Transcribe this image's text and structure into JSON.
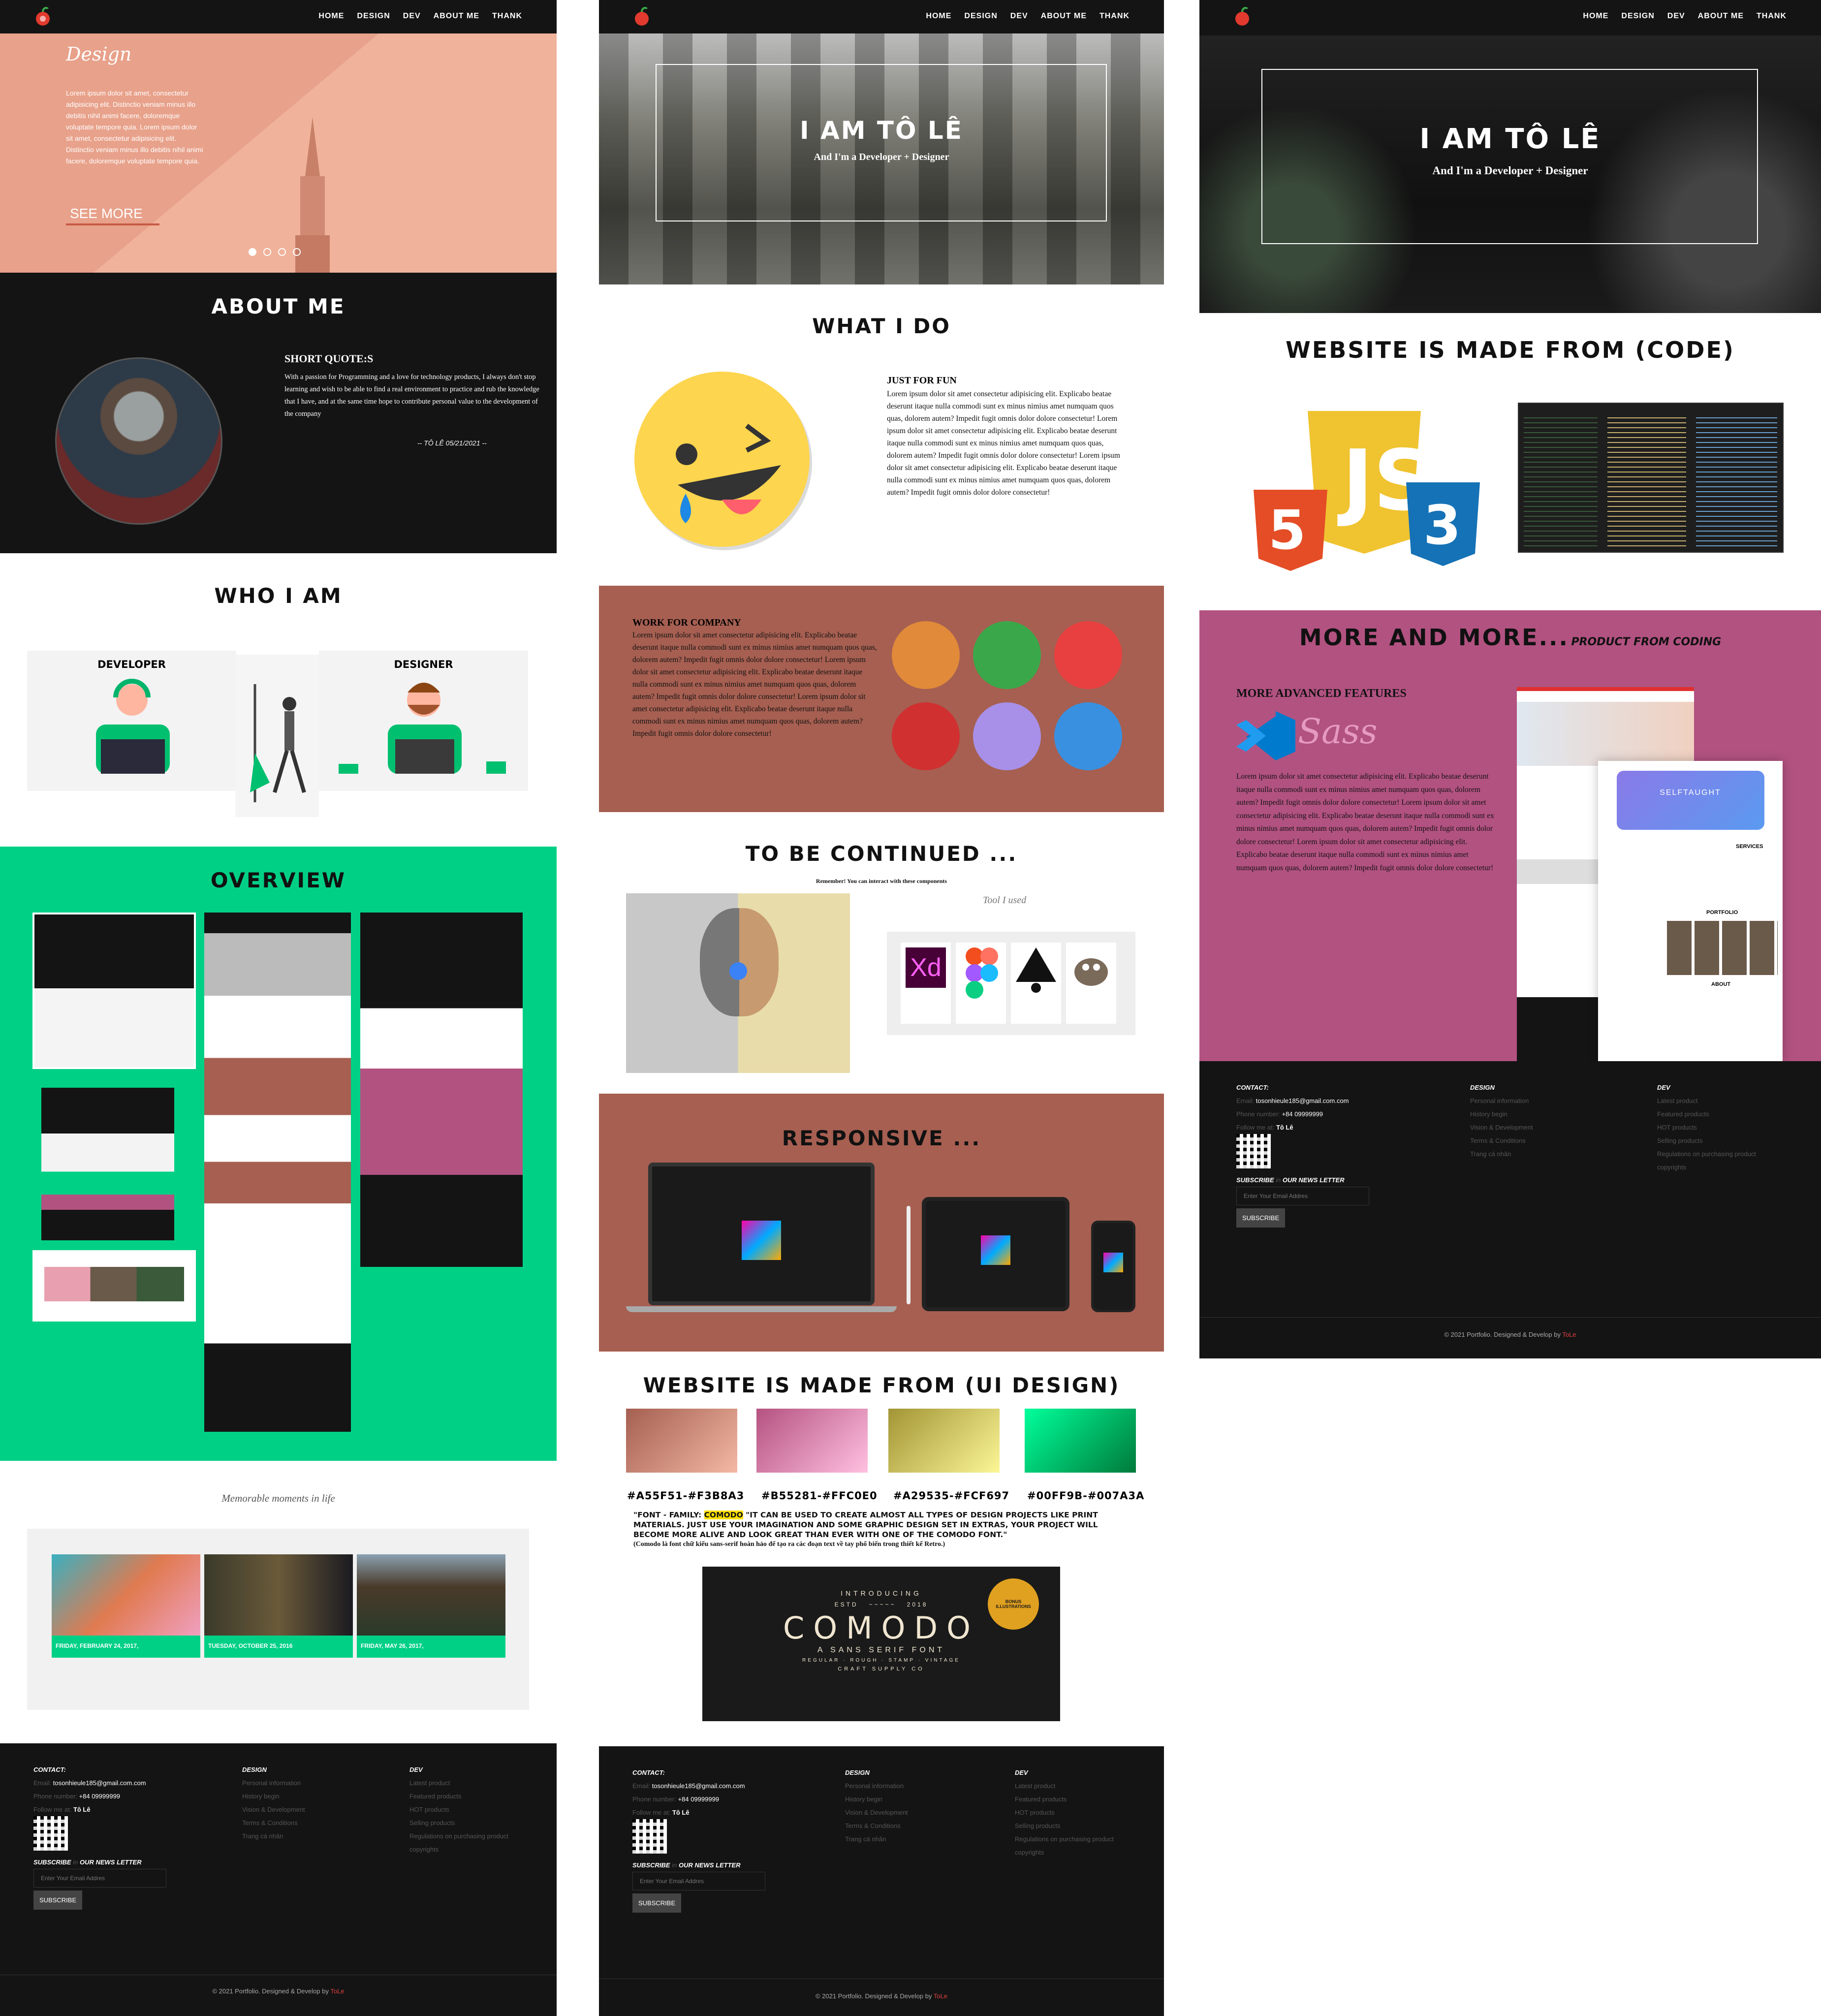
{
  "nav": {
    "items": [
      "HOME",
      "DESIGN",
      "DEV",
      "ABOUT ME",
      "THANK"
    ]
  },
  "col1": {
    "hero": {
      "title": "Design",
      "text": "Lorem ipsum dolor sit amet, consectetur adipisicing elit. Distinctio veniam minus illo debitis nihil animi facere, doloremque voluptate tempore quia. Lorem ipsum dolor sit amet, consectetur adipisicing elit. Distinctio veniam minus illo debitis nihil animi facere, doloremque voluptate tempore quia.",
      "button": "SEE MORE"
    },
    "about": {
      "title": "ABOUT ME",
      "quote_label": "SHORT QUOTE:S",
      "quote": "With a passion for Programming and a love for technology products, I always don't stop learning and wish to be able to find a real environment to practice and rub the knowledge that I have, and at the same time hope to contribute personal value to the development of the company",
      "signature": "-- TÔ LÊ 05/21/2021 --"
    },
    "who": {
      "title": "WHO I AM",
      "developer": "DEVELOPER",
      "designer": "DESIGNER"
    },
    "overview": {
      "title": "OVERVIEW"
    },
    "moments": {
      "title": "Memorable moments in life",
      "cards": [
        "FRIDAY, FEBRUARY 24, 2017,",
        "TUESDAY, OCTOBER 25, 2016",
        "FRIDAY, MAY 26, 2017,"
      ]
    }
  },
  "col2": {
    "hero": {
      "title": "I AM TÔ LÊ",
      "subtitle": "And I'm a Developer + Designer"
    },
    "whatido": {
      "title": "WHAT I DO",
      "label": "JUST FOR FUN",
      "text": "Lorem ipsum dolor sit amet consectetur adipisicing elit. Explicabo beatae deserunt itaque nulla commodi sunt ex minus nimius amet numquam quos quas, dolorem autem? Impedit fugit omnis dolor dolore consectetur! Lorem ipsum dolor sit amet consectetur adipisicing elit. Explicabo beatae deserunt itaque nulla commodi sunt ex minus nimius amet numquam quos quas, dolorem autem? Impedit fugit omnis dolor dolore consectetur! Lorem ipsum dolor sit amet consectetur adipisicing elit. Explicabo beatae deserunt itaque nulla commodi sunt ex minus nimius amet numquam quos quas, dolorem autem? Impedit fugit omnis dolor dolore consectetur!"
    },
    "work": {
      "label": "WORK FOR COMPANY",
      "text": "Lorem ipsum dolor sit amet consectetur adipisicing elit. Explicabo beatae deserunt itaque nulla commodi sunt ex minus nimius amet numquam quos quas, dolorem autem? Impedit fugit omnis dolor dolore consectetur! Lorem ipsum dolor sit amet consectetur adipisicing elit. Explicabo beatae deserunt itaque nulla commodi sunt ex minus nimius amet numquam quos quas, dolorem autem? Impedit fugit omnis dolor dolore consectetur! Lorem ipsum dolor sit amet consectetur adipisicing elit. Explicabo beatae deserunt itaque nulla commodi sunt ex minus nimius amet numquam quos quas, dolorem autem? Impedit fugit omnis dolor dolore consectetur!"
    },
    "continued": {
      "title": "TO BE CONTINUED ...",
      "note": "Remember! You can interact with these components",
      "tools_label": "Tool I used",
      "xd": "Xd"
    },
    "responsive": {
      "title": "RESPONSIVE ..."
    },
    "ui": {
      "title": "WEBSITE IS MADE FROM (UI DESIGN)",
      "hex": [
        "#A55F51-#F3B8A3",
        "#B55281-#FFC0E0",
        "#A29535-#FCF697",
        "#00FF9B-#007A3A"
      ],
      "font_pre": "\"FONT - FAMILY: ",
      "font_name": "COMODO",
      "font_desc": " \"IT CAN BE USED TO CREATE ALMOST ALL TYPES OF DESIGN PROJECTS LIKE PRINT MATERIALS. JUST USE YOUR IMAGINATION AND SOME GRAPHIC DESIGN SET IN EXTRAS, YOUR PROJECT WILL BECOME MORE ALIVE AND LOOK GREAT THAN EVER WITH ONE OF THE COMODO FONT.\"",
      "font_note": "(Comodo là font chữ kiểu sans-serif hoàn hảo để tạo ra các đoạn text về tay phổ biến trong thiết kế Retro.)",
      "poster": {
        "intro": "INTRODUCING",
        "estd": "ESTD",
        "year": "2018",
        "name": "COMODO",
        "sub": "A SANS SERIF FONT",
        "styles": "REGULAR · ROUGH · STAMP · VINTAGE",
        "craft": "CRAFT SUPPLY CO",
        "badge": "BONUS ILLUSTRATIONS"
      }
    }
  },
  "col3": {
    "hero": {
      "title": "I AM TÔ LÊ",
      "subtitle": "And I'm a Developer + Designer"
    },
    "code": {
      "title": "WEBSITE IS MADE FROM (CODE)"
    },
    "more": {
      "title": "MORE AND MORE...",
      "subtitle": "PRODUCT FROM CODING",
      "label": "MORE ADVANCED FEATURES",
      "sass": "Sass",
      "text": "Lorem ipsum dolor sit amet consectetur adipisicing elit. Explicabo beatae deserunt itaque nulla commodi sunt ex minus nimius amet numquam quos quas, dolorem autem? Impedit fugit omnis dolor dolore consectetur! Lorem ipsum dolor sit amet consectetur adipisicing elit. Explicabo beatae deserunt itaque nulla commodi sunt ex minus nimius amet numquam quos quas, dolorem autem? Impedit fugit omnis dolor dolore consectetur! Lorem ipsum dolor sit amet consectetur adipisicing elit. Explicabo beatae deserunt itaque nulla commodi sunt ex minus nimius amet numquam quos quas, dolorem autem? Impedit fugit omnis dolor dolore consectetur!",
      "mock": {
        "brand": "SELFTAUGHT",
        "services": "SERVICES",
        "portfolio": "PORTFOLIO",
        "about": "ABOUT"
      }
    }
  },
  "footer": {
    "contact": "CONTACT:",
    "email_label": "Email:",
    "email": "tosonhieule185@gmail.com.com",
    "phone_label": "Phone number:",
    "phone": "+84 09999999",
    "follow_label": "Follow me at:",
    "follow": "Tô Lê",
    "subscribe_title": "SUBSCRIBE",
    "subscribe_in": "in",
    "subscribe_rest": "OUR NEWS LETTER",
    "subscribe_placeholder": "Enter Your Email Addres",
    "subscribe_button": "SUBSCRIBE",
    "design_title": "DESIGN",
    "design_links": [
      "Personal information",
      "History begin",
      "Vision & Development",
      "Terms & Conditions",
      "Trang cá nhân"
    ],
    "dev_title": "DEV",
    "dev_links": [
      "Latest product",
      "Featured products",
      "HOT products",
      "Selling products",
      "Regulations on purchasing product",
      "copyrights"
    ],
    "copyright": "© 2021 Portfolio. Designed & Develop by",
    "copyright_name": "ToLe"
  },
  "colors": {
    "salmon": "#E8A18A",
    "dark": "#141414",
    "green": "#00D086",
    "brown": "#A65F51",
    "magenta": "#B25281"
  },
  "icons": [
    "cloud-server-icon",
    "user-presentation-icon",
    "chat-icon",
    "qr-code-icon",
    "document-icon",
    "list-icon"
  ]
}
